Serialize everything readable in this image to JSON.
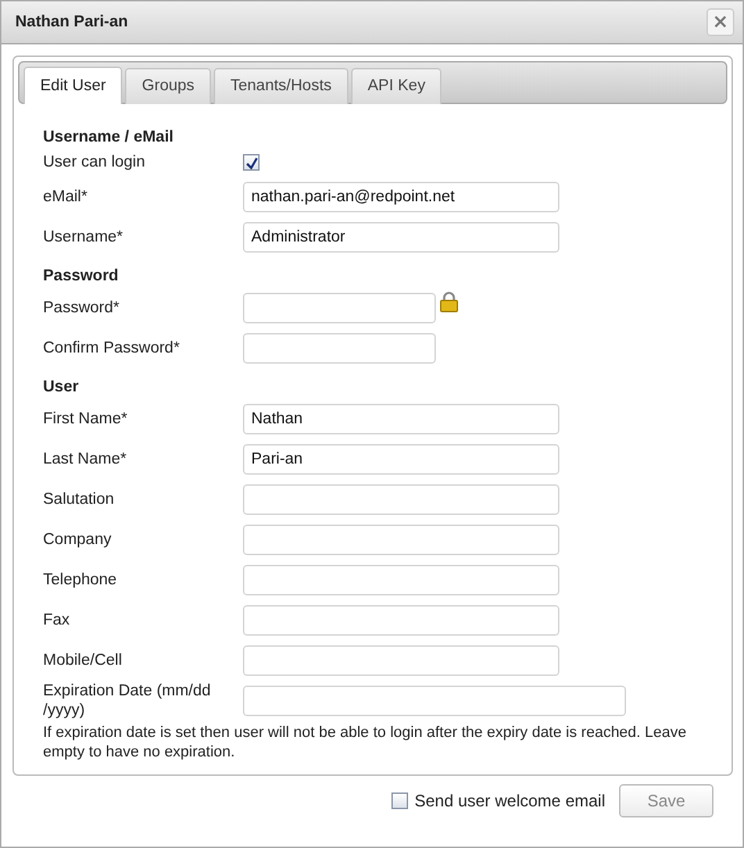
{
  "window": {
    "title": "Nathan Pari-an",
    "close": "×"
  },
  "tabs": [
    {
      "label": "Edit User",
      "selected": true
    },
    {
      "label": "Groups",
      "selected": false
    },
    {
      "label": "Tenants/Hosts",
      "selected": false
    },
    {
      "label": "API Key",
      "selected": false
    }
  ],
  "form": [
    {
      "kind": "heading",
      "label": "Username / eMail"
    },
    {
      "kind": "checkbox",
      "label": "User can login",
      "checked": true
    },
    {
      "kind": "text",
      "label": "eMail*",
      "value": "nathan.pari-an@redpoint.net"
    },
    {
      "kind": "text",
      "label": "Username*",
      "value": "Administrator"
    },
    {
      "kind": "heading",
      "label": "Password"
    },
    {
      "kind": "password",
      "label": "Password*",
      "locked": true
    },
    {
      "kind": "password",
      "label": "Confirm Password*",
      "locked": false
    },
    {
      "kind": "heading",
      "label": "User"
    },
    {
      "kind": "text",
      "label": "First Name*",
      "value": "Nathan"
    },
    {
      "kind": "text",
      "label": "Last Name*",
      "value": "Pari-an"
    },
    {
      "kind": "text",
      "label": "Salutation"
    },
    {
      "kind": "text",
      "label": "Company"
    },
    {
      "kind": "text",
      "label": "Telephone"
    },
    {
      "kind": "text",
      "label": "Fax"
    },
    {
      "kind": "text",
      "label": "Mobile/Cell"
    },
    {
      "kind": "date",
      "label": "Expiration Date (mm/dd /yyyy)"
    },
    {
      "kind": "note",
      "label": "If expiration date is set then user will not be able to login after the expiry date is reached. Leave empty to have no expiration."
    }
  ],
  "footer": {
    "welcome_email": {
      "label": "Send user welcome email",
      "checked": false
    },
    "save": {
      "label": "Save",
      "disabled": true
    }
  }
}
